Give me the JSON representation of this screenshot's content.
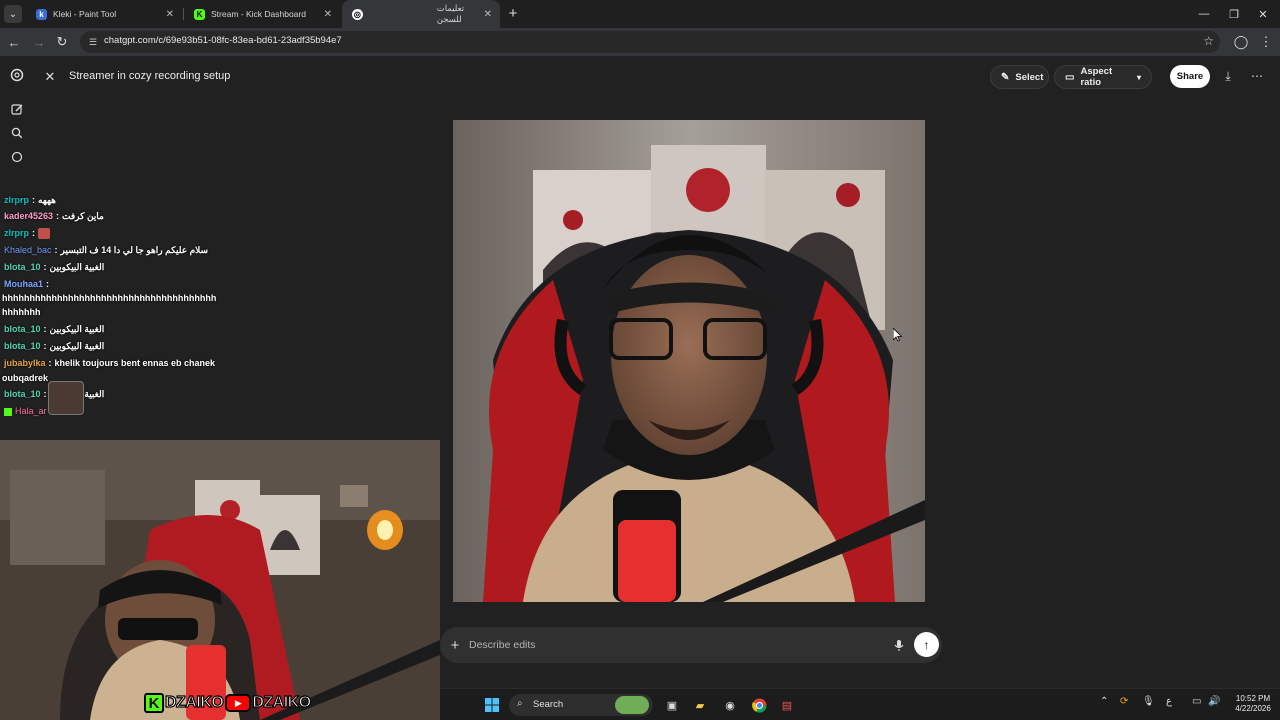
{
  "browser": {
    "tabs": [
      {
        "title": "Kleki - Paint Tool",
        "active": false
      },
      {
        "title": "Stream - Kick Dashboard",
        "active": false
      },
      {
        "title": "تعليمات للسجن",
        "active": true
      }
    ],
    "url": "chatgpt.com/c/69e93b51-08fc-83ea-bd61-23adf35b94e7"
  },
  "image_view": {
    "title": "Streamer in cozy recording setup",
    "select_label": "Select",
    "aspect_ratio_label": "Aspect ratio",
    "share_label": "Share"
  },
  "composer": {
    "placeholder": "Describe edits"
  },
  "chat": {
    "messages": [
      {
        "user": "zlrprp",
        "text": "هههه",
        "color": "#00c1c1"
      },
      {
        "user": "kader45263",
        "text": "ماين كرفت",
        "color": "#ff9bd2"
      },
      {
        "user": "zlrprp",
        "text": "",
        "color": "#00c1c1"
      },
      {
        "user": "Khaled_bac",
        "text": "سلام عليكم راهو جا لي دا 14 ف التبسير",
        "color": "#6e9cff"
      },
      {
        "user": "blota_10",
        "text": "الغبية البيكوبين",
        "color": "#4ed6b0"
      },
      {
        "user": "Mouhaa1",
        "text": "",
        "color": "#7aa7ff"
      },
      {
        "user": "",
        "text": "hhhhhhhhhhhhhhhhhhhhhhhhhhhhhhhhhhhhhhh",
        "color": "#ffffff"
      },
      {
        "user": "",
        "text": "hhhhhhh",
        "color": "#ffffff"
      },
      {
        "user": "blota_10",
        "text": "الغبية البيكوبين",
        "color": "#4ed6b0"
      },
      {
        "user": "blota_10",
        "text": "الغبية البيكوبين",
        "color": "#4ed6b0"
      },
      {
        "user": "jubabylka",
        "text": "khelik toujours bent ennas eb chanek",
        "color": "#e7a33e"
      },
      {
        "user": "",
        "text": "oubqadrek",
        "color": "#ffffff"
      },
      {
        "user": "blota_10",
        "text": "الغبية البيكوبين",
        "color": "#4ed6b0"
      },
      {
        "user": "Hala_ar",
        "text": "",
        "color": "#ff6fa0"
      }
    ]
  },
  "overlay": {
    "brand_name": "DZAIKO",
    "brand_k": "K"
  },
  "taskbar": {
    "search_label": "Search",
    "time": "10:52 PM",
    "date": "4/22/2026",
    "lang": "ع"
  },
  "icons": {
    "accent_kick": "#53fc18",
    "accent_youtube": "#ff0000"
  }
}
